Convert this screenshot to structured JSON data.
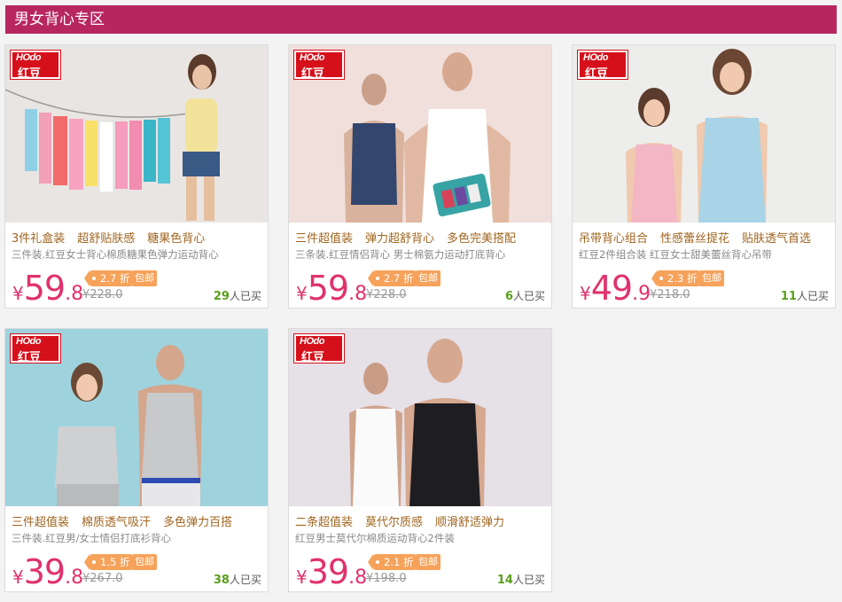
{
  "section": {
    "title": "男女背心专区"
  },
  "colors": {
    "header_bg": "#b8265f",
    "price": "#e0326c",
    "tag": "#f6a25a",
    "sold": "#5a9e1c",
    "feature": "#a0651f"
  },
  "brand": {
    "logo_latin": "HOdo",
    "logo_cn": "红豆"
  },
  "products": [
    {
      "features": [
        "3件礼盒装",
        "超舒贴肤感",
        "糖果色背心"
      ],
      "description": "三件装.红豆女士背心棉质糖果色弹力运动背心",
      "currency": "¥",
      "price_int": "59",
      "price_dec": ".8",
      "discount": "2.7 折",
      "shipping": "包邮",
      "original_price": "¥228.0",
      "sold_count": "29",
      "sold_suffix": "人已买"
    },
    {
      "features": [
        "三件超值装",
        "弹力超舒背心",
        "多色完美搭配"
      ],
      "description": "三条装.红豆情侣背心 男士棉氨力运动打底背心",
      "currency": "¥",
      "price_int": "59",
      "price_dec": ".8",
      "discount": "2.7 折",
      "shipping": "包邮",
      "original_price": "¥228.0",
      "sold_count": "6",
      "sold_suffix": "人已买"
    },
    {
      "features": [
        "吊带背心组合",
        "性感蕾丝提花",
        "贴肤透气首选"
      ],
      "description": "红豆2件组合装 红豆女士甜美蕾丝背心吊带",
      "currency": "¥",
      "price_int": "49",
      "price_dec": ".9",
      "discount": "2.3 折",
      "shipping": "包邮",
      "original_price": "¥218.0",
      "sold_count": "11",
      "sold_suffix": "人已买"
    },
    {
      "features": [
        "三件超值装",
        "棉质透气吸汗",
        "多色弹力百搭"
      ],
      "description": "三件装.红豆男/女士情侣打底衫背心",
      "currency": "¥",
      "price_int": "39",
      "price_dec": ".8",
      "discount": "1.5 折",
      "shipping": "包邮",
      "original_price": "¥267.0",
      "sold_count": "38",
      "sold_suffix": "人已买"
    },
    {
      "features": [
        "二条超值装",
        "莫代尔质感",
        "顺滑舒适弹力"
      ],
      "description": "红豆男士莫代尔棉质运动背心2件装",
      "currency": "¥",
      "price_int": "39",
      "price_dec": ".8",
      "discount": "2.1 折",
      "shipping": "包邮",
      "original_price": "¥198.0",
      "sold_count": "14",
      "sold_suffix": "人已买"
    }
  ]
}
